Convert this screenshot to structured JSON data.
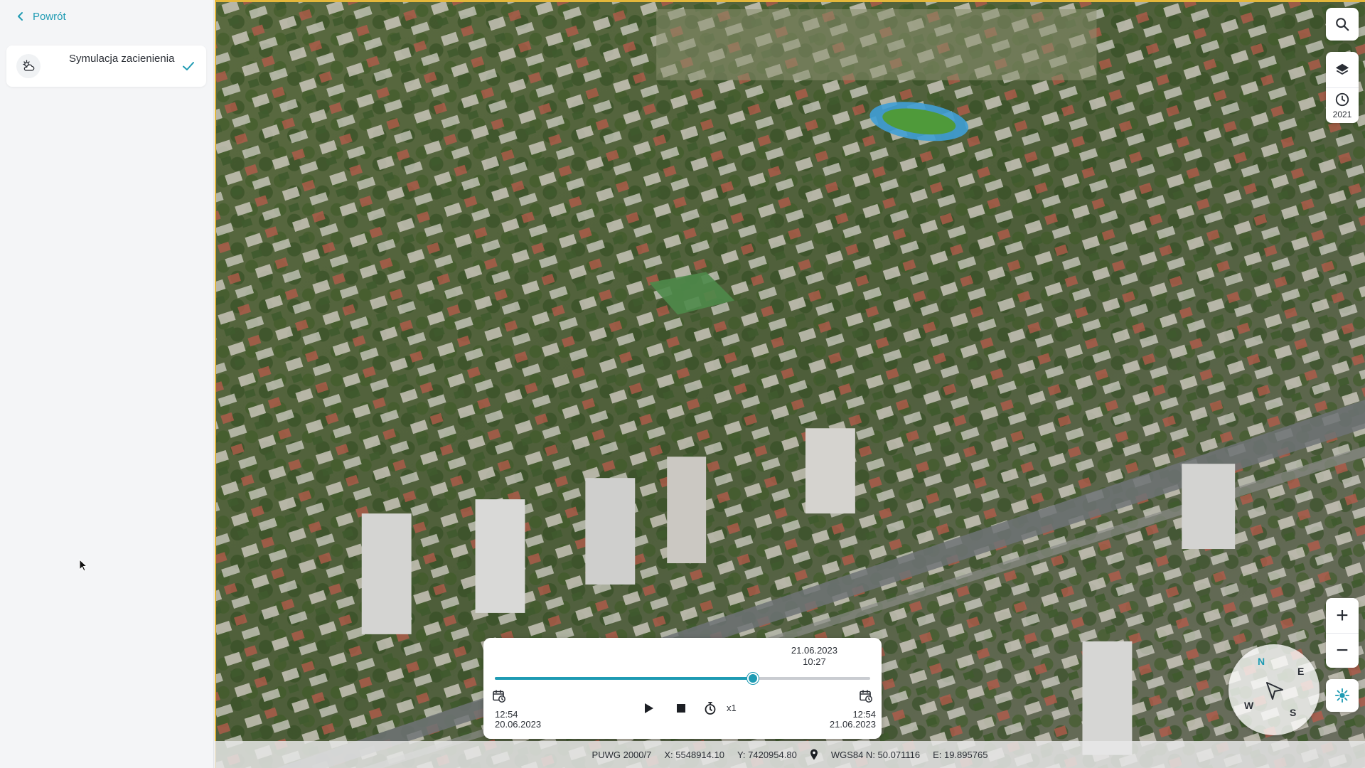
{
  "sidebar": {
    "back_label": "Powrót",
    "tool": {
      "icon": "cloud-sun-icon",
      "label": "Symulacja zacienienia",
      "checked": true,
      "check_icon": "check-icon"
    }
  },
  "map": {
    "controls": {
      "search_icon": "search-icon",
      "layers_icon": "layers-icon",
      "history_icon": "clock-icon",
      "year": "2021",
      "zoom_in": "+",
      "zoom_out": "−",
      "sun_icon": "sun-icon"
    },
    "compass": {
      "n": "N",
      "e": "E",
      "s": "S",
      "w": "W"
    }
  },
  "playback": {
    "current_date": "21.06.2023",
    "current_time": "10:27",
    "progress": 0.687,
    "start_time": "12:54",
    "start_date": "20.06.2023",
    "end_time": "12:54",
    "end_date": "21.06.2023",
    "speed": "x1"
  },
  "status": {
    "crs": "PUWG 2000/7",
    "x": "X: 5548914.10",
    "y": "Y: 7420954.80",
    "wgs": "WGS84 N: 50.071116",
    "e": "E: 19.895765"
  },
  "colors": {
    "accent": "#1f9bb3",
    "frame": "#e4b73a"
  }
}
